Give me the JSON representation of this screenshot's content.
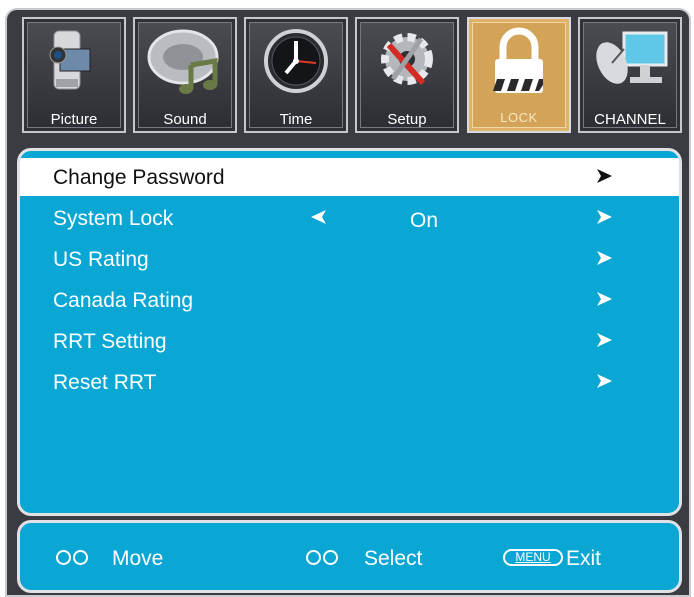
{
  "tabs": [
    {
      "label": "Picture",
      "icon": "camcorder-icon",
      "active": false
    },
    {
      "label": "Sound",
      "icon": "music-note-icon",
      "active": false
    },
    {
      "label": "Time",
      "icon": "clock-icon",
      "active": false
    },
    {
      "label": "Setup",
      "icon": "gear-tools-icon",
      "active": false
    },
    {
      "label": "LOCK",
      "icon": "padlock-icon",
      "active": true
    },
    {
      "label": "CHANNEL",
      "icon": "satellite-monitor-icon",
      "active": false
    }
  ],
  "menu": {
    "items": [
      {
        "label": "Change Password",
        "value": "",
        "selected": true
      },
      {
        "label": "System Lock",
        "value": "On",
        "selected": false
      },
      {
        "label": "US Rating",
        "value": "",
        "selected": false
      },
      {
        "label": "Canada Rating",
        "value": "",
        "selected": false
      },
      {
        "label": "RRT Setting",
        "value": "",
        "selected": false
      },
      {
        "label": "Reset RRT",
        "value": "",
        "selected": false
      }
    ]
  },
  "footer": {
    "move_label": "Move",
    "select_label": "Select",
    "menu_key": "MENU",
    "exit_label": "Exit"
  },
  "colors": {
    "panel": "#0aa6d4",
    "frame": "#3a3c41",
    "active_tab": "#d3a457",
    "selected_row": "#ffffff"
  }
}
